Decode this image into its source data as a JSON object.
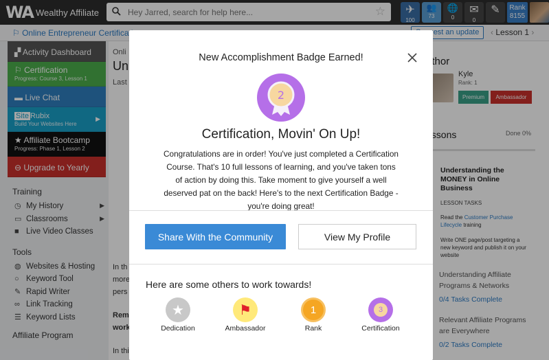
{
  "topbar": {
    "logo_mark": "WA",
    "logo_text": "Wealthy Affiliate",
    "search_placeholder": "Hey Jarred, search for help here...",
    "icons": [
      {
        "name": "airplane-icon",
        "glyph": "✈",
        "count": "100",
        "color": "#3a6ea5"
      },
      {
        "name": "users-icon",
        "glyph": "👥",
        "count": "73",
        "color": "#5a9fd4"
      },
      {
        "name": "globe-icon",
        "glyph": "🌐",
        "count": "0",
        "color": "#444"
      },
      {
        "name": "mail-icon",
        "glyph": "✉",
        "count": "0",
        "color": "#444"
      },
      {
        "name": "pen-icon",
        "glyph": "✎",
        "count": "",
        "color": "#444"
      }
    ],
    "rank_label": "Rank",
    "rank_value": "8155"
  },
  "crumbbar": {
    "breadcrumb": "Online Entrepreneur Certification",
    "suggest": "Suggest an update",
    "lesson": "Lesson 1"
  },
  "sidebar": {
    "activity": "Activity Dashboard",
    "certification": "Certification",
    "cert_progress": "Progress: Course 3, Lesson 1",
    "chat": "Live Chat",
    "siterubix_a": "Site",
    "siterubix_b": "Rubix",
    "siterubix_sub": "Build Your Websites Here",
    "bootcamp": "Affiliate Bootcamp",
    "bootcamp_progress": "Progress: Phase 1, Lesson 2",
    "upgrade": "Upgrade to Yearly",
    "training_heading": "Training",
    "training": [
      "My History",
      "Classrooms",
      "Live Video Classes"
    ],
    "tools_heading": "Tools",
    "tools": [
      "Websites & Hosting",
      "Keyword Tool",
      "Rapid Writer",
      "Link Tracking",
      "Keyword Lists"
    ],
    "affiliate_heading": "Affiliate Program"
  },
  "background": {
    "content_crumb": "Onli",
    "content_title": "Un",
    "content_last": "Last",
    "para_a": "In th",
    "para_b": "more",
    "para_c": "pers",
    "rem": "Rem",
    "work": "work",
    "inthi": "In thi",
    "author_heading": "uthor",
    "author_name": "Kyle",
    "author_rank": "Rank: 1",
    "premium": "Premium",
    "ambassador": "Ambassador",
    "lessons_heading": "essons",
    "done": "Done 0%",
    "task_title": "Understanding the MONEY in Online Business",
    "lesson_tasks": "LESSON TASKS",
    "task1_a": "Read the",
    "task1_link": "Customer Purchase Lifecycle",
    "task1_b": "training",
    "task2": "Write ONE page/post targeting a new keyword and publish it on your website",
    "next1": "Understanding Affiliate Programs & Networks",
    "next1_tasks": "0/4 Tasks Complete",
    "next2": "Relevant Affiliate Programs are Everywhere",
    "next2_tasks": "0/2 Tasks Complete"
  },
  "modal": {
    "heading": "New Accomplishment Badge Earned!",
    "badge_number": "2",
    "badge_color": "#b56fe8",
    "title": "Certification, Movin' On Up!",
    "description": "Congratulations are in order! You've just completed a Certification Course. That's 10 full lessons of learning, and you've taken tons of action by doing this. Take moment to give yourself a well deserved pat on the back! Here's to the next Certification Badge - you're doing great!",
    "share_button": "Share With the Community",
    "profile_button": "View My Profile",
    "others_title": "Here are some others to work towards!",
    "others": [
      {
        "label": "Dedication",
        "symbol": "★",
        "color": "#c8c8c8"
      },
      {
        "label": "Ambassador",
        "symbol": "⚑",
        "color": "#ffe97a"
      },
      {
        "label": "Rank",
        "symbol": "1",
        "color": "#f5a623"
      },
      {
        "label": "Certification",
        "symbol": "3",
        "color": "#b56fe8"
      }
    ]
  }
}
